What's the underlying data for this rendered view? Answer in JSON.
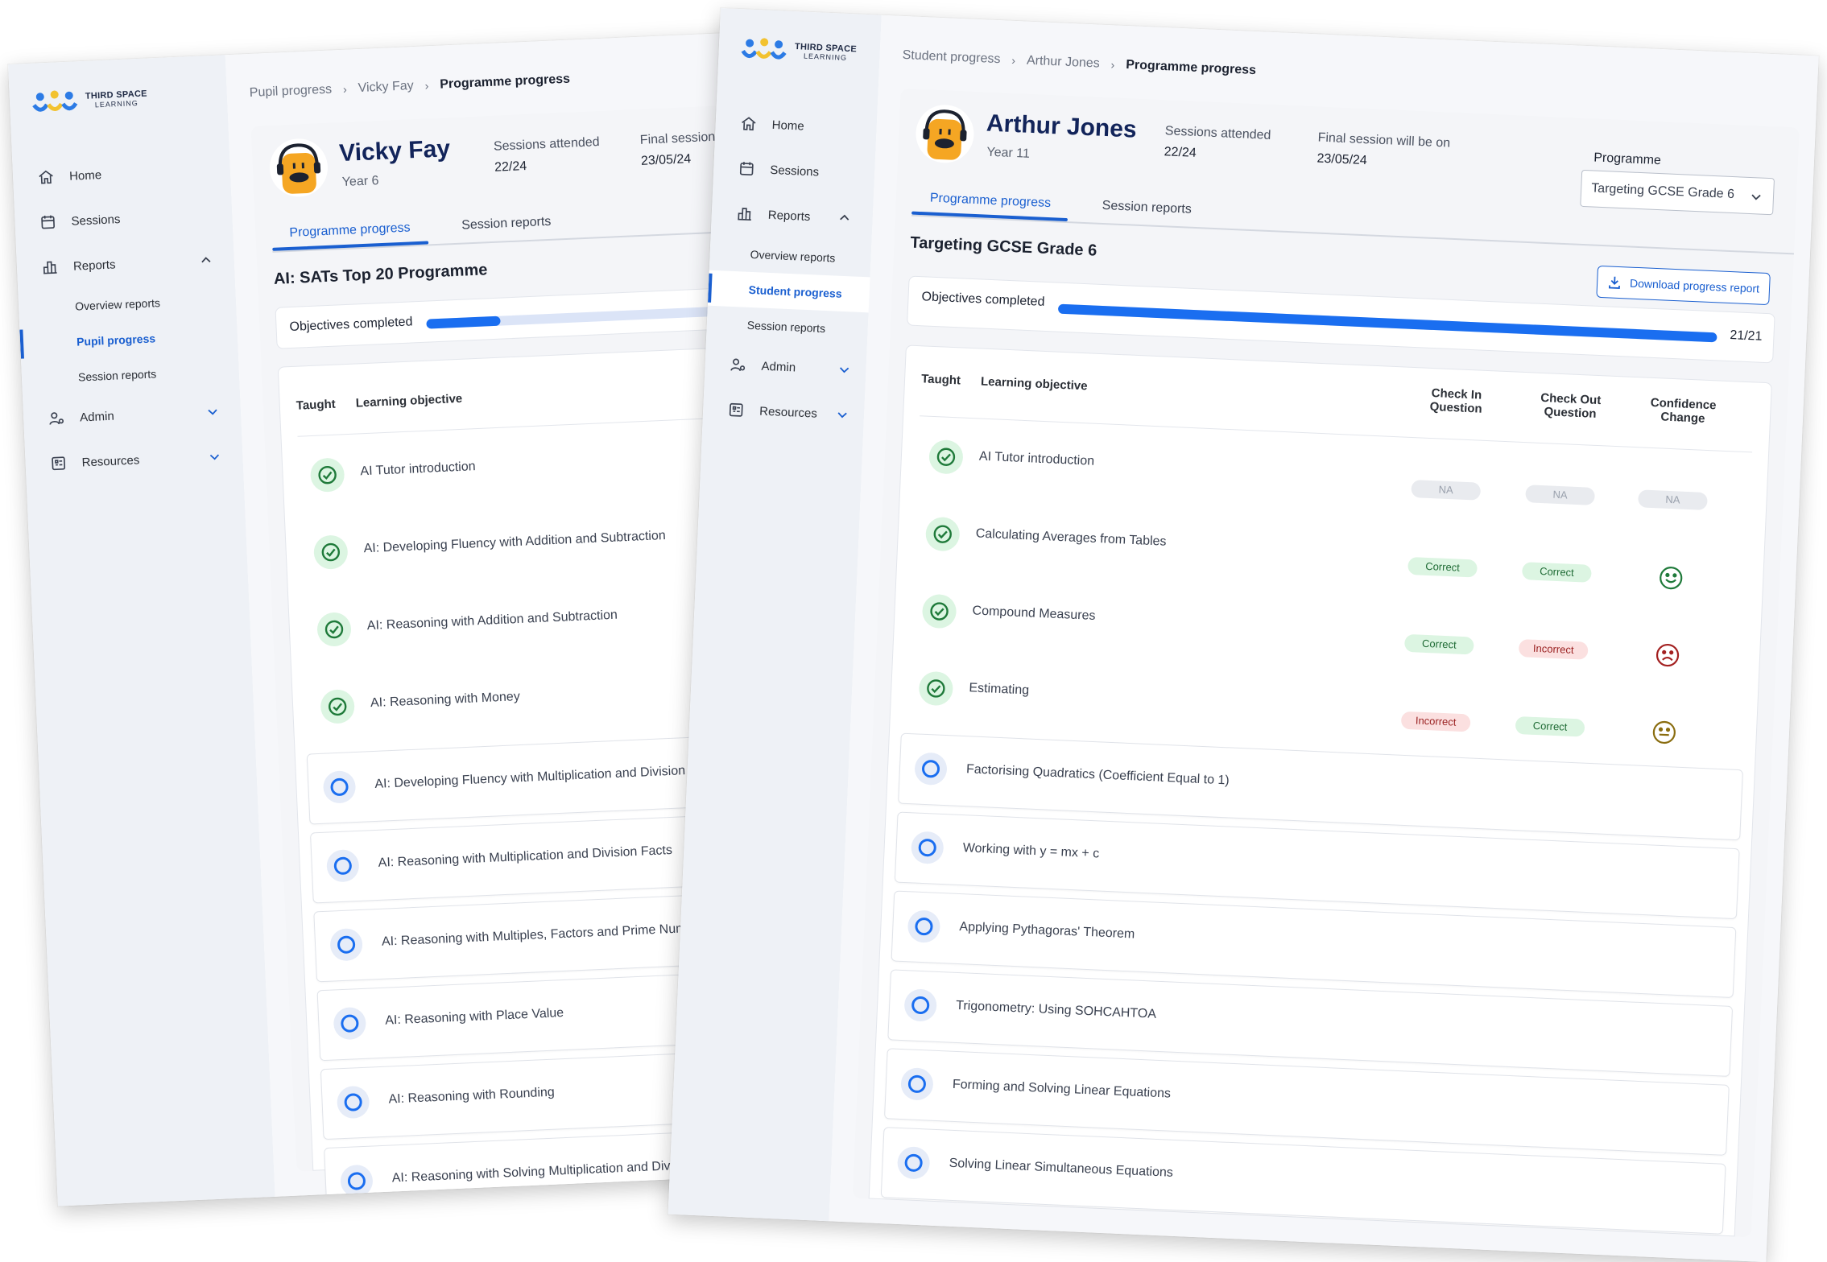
{
  "brand": {
    "name": "THIRD SPACE",
    "sub": "LEARNING"
  },
  "colors": {
    "accent": "#1a6ef0",
    "nav_active": "#1a5fd0",
    "correct": "#1f6b35",
    "incorrect": "#9b2222",
    "title": "#12245a"
  },
  "left": {
    "nav": {
      "home": "Home",
      "sessions": "Sessions",
      "reports": "Reports",
      "overview": "Overview reports",
      "progress": "Pupil progress",
      "session_reports": "Session reports",
      "admin": "Admin",
      "resources": "Resources"
    },
    "breadcrumb": [
      "Pupil progress",
      "Vicky Fay",
      "Programme progress"
    ],
    "student": {
      "name": "Vicky Fay",
      "year": "Year 6"
    },
    "stats": [
      {
        "label": "Sessions attended",
        "value": "22/24"
      },
      {
        "label": "Final session will be on",
        "value": "23/05/24"
      }
    ],
    "tabs": [
      "Programme progress",
      "Session reports"
    ],
    "programme_title": "AI: SATs Top 20 Programme",
    "objectives_label": "Objectives completed",
    "progress_fraction": 0.2,
    "table_headers": {
      "taught": "Taught",
      "objective": "Learning objective"
    },
    "rows": [
      {
        "label": "AI Tutor introduction",
        "taught": true
      },
      {
        "label": "AI: Developing Fluency with Addition and Subtraction",
        "taught": true
      },
      {
        "label": "AI: Reasoning with Addition and Subtraction",
        "taught": true
      },
      {
        "label": "AI: Reasoning with Money",
        "taught": true
      },
      {
        "label": "AI: Developing Fluency with Multiplication and Division",
        "taught": false
      },
      {
        "label": "AI: Reasoning with Multiplication and Division Facts",
        "taught": false
      },
      {
        "label": "AI: Reasoning with Multiples, Factors and Prime Numbers",
        "taught": false
      },
      {
        "label": "AI: Reasoning with Place Value",
        "taught": false
      },
      {
        "label": "AI: Reasoning with Rounding",
        "taught": false
      },
      {
        "label": "AI: Reasoning with Solving Multiplication and Division",
        "taught": false
      }
    ]
  },
  "right": {
    "nav": {
      "home": "Home",
      "sessions": "Sessions",
      "reports": "Reports",
      "overview": "Overview reports",
      "progress": "Student progress",
      "session_reports": "Session reports",
      "admin": "Admin",
      "resources": "Resources"
    },
    "breadcrumb": [
      "Student progress",
      "Arthur Jones",
      "Programme progress"
    ],
    "student": {
      "name": "Arthur Jones",
      "year": "Year 11"
    },
    "stats": [
      {
        "label": "Sessions attended",
        "value": "22/24"
      },
      {
        "label": "Final session will be on",
        "value": "23/05/24"
      }
    ],
    "programme_select": {
      "label": "Programme",
      "value": "Targeting GCSE Grade 6"
    },
    "tabs": [
      "Programme progress",
      "Session reports"
    ],
    "programme_title": "Targeting GCSE Grade 6",
    "download_label": "Download progress report",
    "objectives_label": "Objectives completed",
    "objectives_count": "21/21",
    "progress_fraction": 1.0,
    "table_headers": {
      "taught": "Taught",
      "objective": "Learning objective",
      "check_in": "Check In Question",
      "check_out": "Check Out Question",
      "confidence": "Confidence Change"
    },
    "rows": [
      {
        "label": "AI Tutor introduction",
        "taught": true,
        "check_in": "NA",
        "check_out": "NA",
        "confidence": "NA"
      },
      {
        "label": "Calculating Averages from Tables",
        "taught": true,
        "check_in": "Correct",
        "check_out": "Correct",
        "confidence": "happy"
      },
      {
        "label": "Compound Measures",
        "taught": true,
        "check_in": "Correct",
        "check_out": "Incorrect",
        "confidence": "sad"
      },
      {
        "label": "Estimating",
        "taught": true,
        "check_in": "Incorrect",
        "check_out": "Correct",
        "confidence": "neutral"
      },
      {
        "label": "Factorising Quadratics (Coefficient Equal to 1)",
        "taught": false
      },
      {
        "label": "Working with y = mx + c",
        "taught": false
      },
      {
        "label": "Applying Pythagoras' Theorem",
        "taught": false
      },
      {
        "label": "Trigonometry: Using SOHCAHTOA",
        "taught": false
      },
      {
        "label": "Forming and Solving Linear Equations",
        "taught": false
      },
      {
        "label": "Solving Linear Simultaneous Equations",
        "taught": false
      }
    ]
  }
}
